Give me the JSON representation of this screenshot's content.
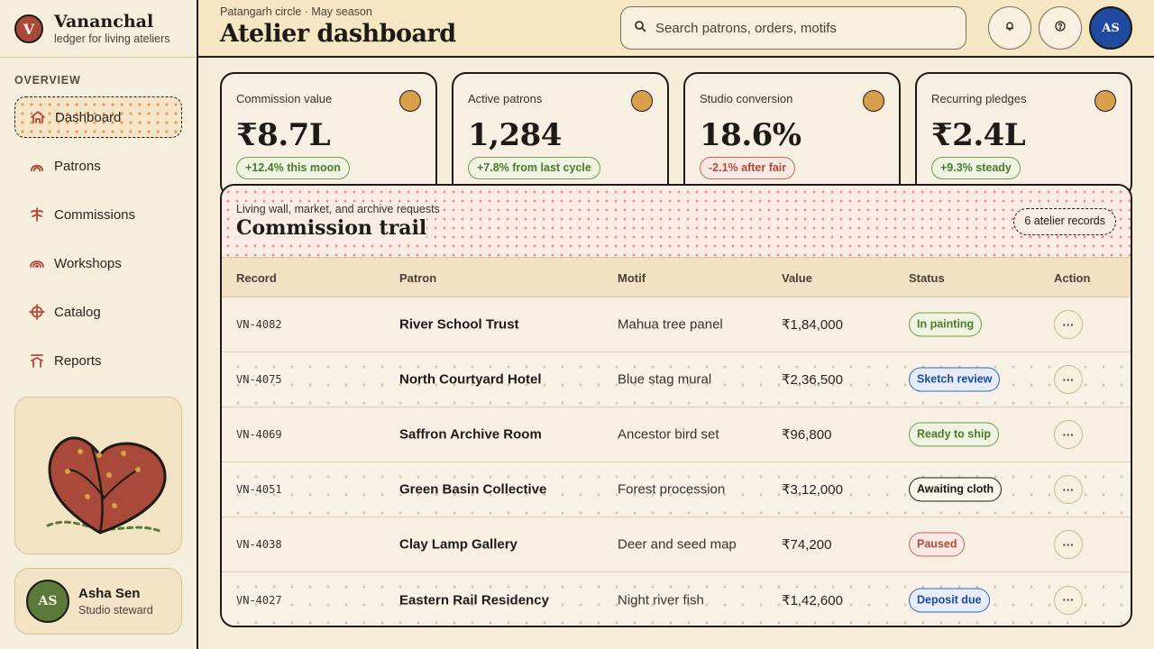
{
  "brand": {
    "logo_letter": "V",
    "name": "Vananchal",
    "subtitle": "ledger for living ateliers"
  },
  "sidebar": {
    "heading": "OVERVIEW",
    "items": [
      {
        "label": "Dashboard",
        "icon": "home-icon",
        "active": true
      },
      {
        "label": "Patrons",
        "icon": "arc-icon",
        "active": false
      },
      {
        "label": "Commissions",
        "icon": "sprout-icon",
        "active": false
      },
      {
        "label": "Workshops",
        "icon": "rainbow-icon",
        "active": false
      },
      {
        "label": "Catalog",
        "icon": "target-icon",
        "active": false
      },
      {
        "label": "Reports",
        "icon": "stack-icon",
        "active": false
      }
    ],
    "user": {
      "initials": "AS",
      "name": "Asha Sen",
      "role": "Studio steward"
    }
  },
  "header": {
    "eyebrow": "Patangarh circle · May season",
    "title": "Atelier dashboard",
    "search_placeholder": "Search patrons, orders, motifs",
    "avatar_initials": "AS"
  },
  "stats": [
    {
      "label": "Commission value",
      "value": "₹8.7L",
      "delta": "+12.4% this moon",
      "trend": "up"
    },
    {
      "label": "Active patrons",
      "value": "1,284",
      "delta": "+7.8% from last cycle",
      "trend": "up"
    },
    {
      "label": "Studio conversion",
      "value": "18.6%",
      "delta": "-2.1% after fair",
      "trend": "down"
    },
    {
      "label": "Recurring pledges",
      "value": "₹2.4L",
      "delta": "+9.3% steady",
      "trend": "up"
    }
  ],
  "table": {
    "eyebrow": "Living wall, market, and archive requests",
    "title": "Commission trail",
    "record_count": "6 atelier records",
    "columns": [
      "Record",
      "Patron",
      "Motif",
      "Value",
      "Status",
      "Action"
    ],
    "rows": [
      {
        "record": "VN-4082",
        "patron": "River School Trust",
        "motif": "Mahua tree panel",
        "value": "₹1,84,000",
        "status": "In painting",
        "tone": "green",
        "action": "···"
      },
      {
        "record": "VN-4075",
        "patron": "North Courtyard Hotel",
        "motif": "Blue stag mural",
        "value": "₹2,36,500",
        "status": "Sketch review",
        "tone": "blue",
        "action": "···"
      },
      {
        "record": "VN-4069",
        "patron": "Saffron Archive Room",
        "motif": "Ancestor bird set",
        "value": "₹96,800",
        "status": "Ready to ship",
        "tone": "green",
        "action": "···"
      },
      {
        "record": "VN-4051",
        "patron": "Green Basin Collective",
        "motif": "Forest procession",
        "value": "₹3,12,000",
        "status": "Awaiting cloth",
        "tone": "black",
        "action": "···"
      },
      {
        "record": "VN-4038",
        "patron": "Clay Lamp Gallery",
        "motif": "Deer and seed map",
        "value": "₹74,200",
        "status": "Paused",
        "tone": "red",
        "action": "···"
      },
      {
        "record": "VN-4027",
        "patron": "Eastern Rail Residency",
        "motif": "Night river fish",
        "value": "₹1,42,600",
        "status": "Deposit due",
        "tone": "blue",
        "action": "···"
      }
    ]
  },
  "colors": {
    "accent_red": "#a8493a",
    "accent_gold": "#d8a04c",
    "accent_blue": "#1f4aa0",
    "accent_green": "#5b7a3a",
    "ink": "#1e1a16",
    "paper": "#f5ecd9"
  }
}
